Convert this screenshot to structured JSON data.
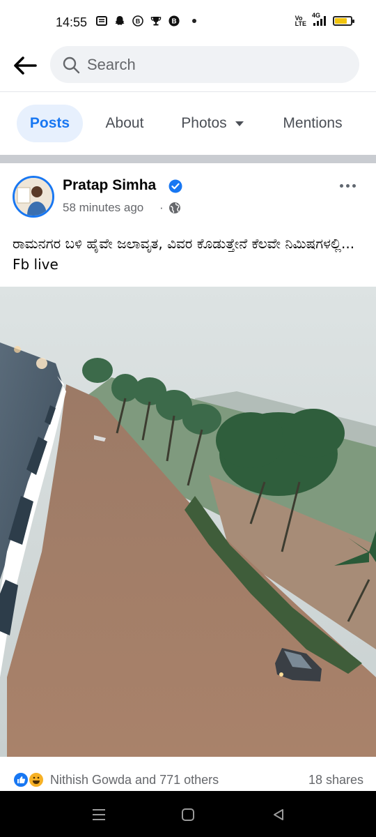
{
  "status_bar": {
    "time": "14:55",
    "left_icons": [
      "news-icon",
      "snapchat-icon",
      "bitcoin-icon",
      "trophy-icon",
      "b-app-icon"
    ],
    "network": "4G",
    "volte": "Vo LTE",
    "battery_level": 0.7,
    "battery_color": "#f1c40f"
  },
  "search": {
    "placeholder": "Search"
  },
  "tabs": [
    {
      "label": "Posts",
      "active": true
    },
    {
      "label": "About",
      "active": false
    },
    {
      "label": "Photos",
      "active": false
    },
    {
      "label": "Mentions",
      "active": false
    }
  ],
  "post": {
    "author": "Pratap Simha",
    "verified": true,
    "time": "58 minutes ago",
    "separator": "·",
    "privacy": "globe-icon",
    "text": "ರಾಮನಗರ ಬಳಿ ಹೈವೇ ಜಲಾವೃತ, ವಿವರ ಕೊಡುತ್ತೇನೆ ಕೆಲವೇ ನಿಮಿಷಗಳಲ್ಲಿ... Fb live",
    "reactions": {
      "types": [
        "like",
        "haha"
      ],
      "summary": "Nithish Gowda and 771 others",
      "shares": "18 shares"
    }
  },
  "colors": {
    "accent": "#1877f2",
    "active_tab_bg": "#e7f0fd",
    "secondary_text": "#65676b"
  }
}
